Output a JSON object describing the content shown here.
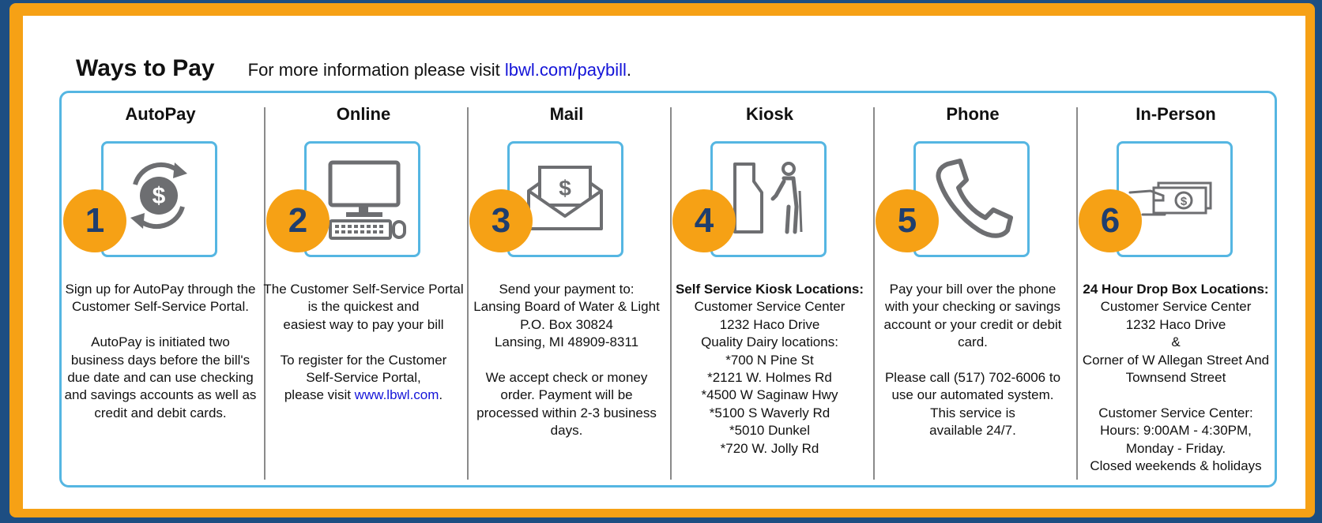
{
  "header": {
    "title": "Ways to Pay",
    "info_prefix": "For more information please visit ",
    "info_link": "lbwl.com/paybill",
    "info_suffix": "."
  },
  "methods": [
    {
      "name": "AutoPay",
      "number": "1",
      "icon": "dollar-refresh-icon",
      "lines": [
        "Sign up for AutoPay through the",
        "Customer Self-Service Portal.",
        "",
        "AutoPay is initiated two",
        "business days before the bill's",
        "due date and can use checking",
        "and savings accounts as well as",
        "credit and debit cards."
      ]
    },
    {
      "name": "Online",
      "number": "2",
      "icon": "desktop-computer-icon",
      "lines": [
        "The Customer Self-Service Portal",
        "is the quickest and",
        "easiest way to pay your bill",
        "",
        "To register for the Customer",
        "Self-Service Portal,"
      ],
      "link_prefix": "please visit ",
      "link_text": "www.lbwl.com",
      "link_suffix": "."
    },
    {
      "name": "Mail",
      "number": "3",
      "icon": "envelope-dollar-icon",
      "lines": [
        "Send your payment to:",
        "Lansing Board of Water & Light",
        "P.O. Box 30824",
        "Lansing, MI 48909-8311",
        "",
        "We accept check or money",
        "order. Payment will be",
        "processed within 2-3 business",
        "days."
      ]
    },
    {
      "name": "Kiosk",
      "number": "4",
      "icon": "kiosk-person-icon",
      "bold_line": "Self Service Kiosk Locations:",
      "lines": [
        "Customer Service Center",
        "1232 Haco Drive",
        "Quality Dairy locations:",
        "*700 N Pine St",
        "*2121 W. Holmes Rd",
        "*4500 W Saginaw Hwy",
        "*5100 S Waverly Rd",
        "*5010 Dunkel",
        "*720 W. Jolly Rd"
      ]
    },
    {
      "name": "Phone",
      "number": "5",
      "icon": "phone-handset-icon",
      "lines": [
        "Pay your bill over the phone",
        "with your checking or savings",
        "account or your credit or debit",
        "card.",
        "",
        "Please call (517) 702-6006 to",
        "use our automated system.",
        "This service is",
        "available 24/7."
      ]
    },
    {
      "name": "In-Person",
      "number": "6",
      "icon": "hand-cash-icon",
      "bold_line": "24 Hour Drop Box Locations:",
      "lines": [
        "Customer Service Center",
        "1232 Haco Drive",
        "&",
        "Corner of W Allegan Street And",
        "Townsend Street",
        "",
        "Customer Service Center:",
        "Hours: 9:00AM - 4:30PM,",
        "Monday - Friday.",
        "Closed weekends & holidays"
      ]
    }
  ],
  "colors": {
    "background": "#1d4e82",
    "frame": "#f6a115",
    "border": "#55b6e2",
    "badge": "#f6a115",
    "badge_text": "#1f3e6e",
    "icon": "#6d6e71",
    "link": "#1414d8"
  }
}
